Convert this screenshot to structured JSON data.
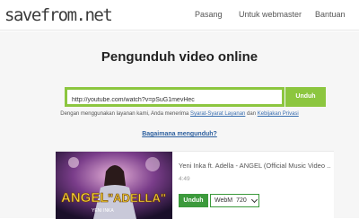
{
  "header": {
    "logo_text": "savefrom.net",
    "nav": [
      "Pasang",
      "Untuk webmaster",
      "Bantuan"
    ]
  },
  "main": {
    "title": "Pengunduh video online",
    "search": {
      "value": "http://youtube.com/watch?v=pSuG1mevHec"
    },
    "download_label": "Unduh",
    "terms": {
      "prefix": "Dengan menggunakan layanan kami, Anda menerima ",
      "link1": "Syarat-Syarat Layanan",
      "middle": " dan ",
      "link2": "Kebijakan Privasi"
    },
    "howto_link": "Bagaimana mengunduh?"
  },
  "result": {
    "thumbnail": {
      "text1": "ANGEL",
      "text2": "\"ADELLA\"",
      "caption": "YENI INKA"
    },
    "title": "Yeni Inka ft. Adella - ANGEL (Official Music Video ...",
    "duration": "4:49",
    "download_label": "Unduh",
    "format": {
      "type": "WebM",
      "quality": "720"
    }
  },
  "colors": {
    "accent": "#8cc63f",
    "download_green": "#3c9a3c",
    "link_blue": "#2c5f9e"
  }
}
